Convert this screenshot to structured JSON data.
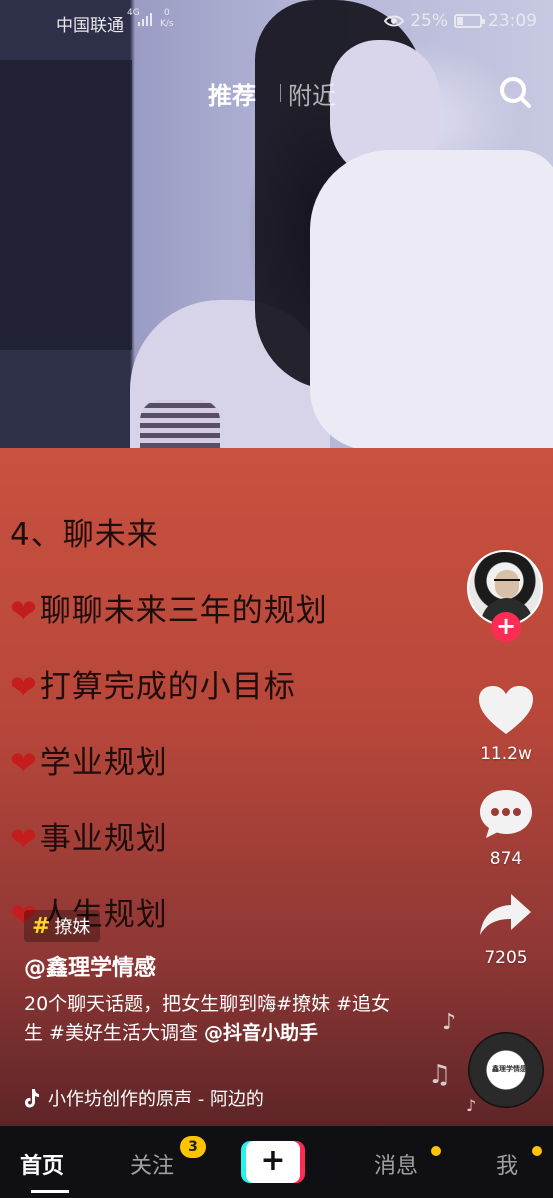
{
  "status_bar": {
    "carrier": "中国联通",
    "signal_label": "4G",
    "speed_value": "0",
    "speed_unit": "K/s",
    "battery_percent": "25%",
    "battery_level": 0.25,
    "time": "23:09"
  },
  "top_tabs": [
    {
      "label": "推荐",
      "active": true
    },
    {
      "label": "附近",
      "active": false
    }
  ],
  "video_text": {
    "lines": [
      "4、聊未来",
      "聊聊未来三年的规划",
      "打算完成的小目标",
      "学业规划",
      "事业规划",
      "人生规划"
    ],
    "heart": "❤"
  },
  "actions": {
    "follow_plus": "+",
    "likes": "11.2w",
    "comments": "874",
    "shares": "7205"
  },
  "caption": {
    "tag_hash": "#",
    "tag": "撩妹",
    "author": "@鑫理学情感",
    "text": "20个聊天话题，把女生聊到嗨#撩妹 #追女生 #美好生活大调查 ",
    "mention": "@抖音小助手",
    "music": "小作坊创作的原声 - 阿边的",
    "disc_label": "鑫理学情感"
  },
  "bottom_nav": {
    "home": "首页",
    "follow": "关注",
    "follow_badge": "3",
    "create": "+",
    "messages": "消息",
    "me": "我"
  },
  "colors": {
    "accent_red": "#fe2c55",
    "accent_cyan": "#25f4ee",
    "badge_yellow": "#ffc300"
  }
}
